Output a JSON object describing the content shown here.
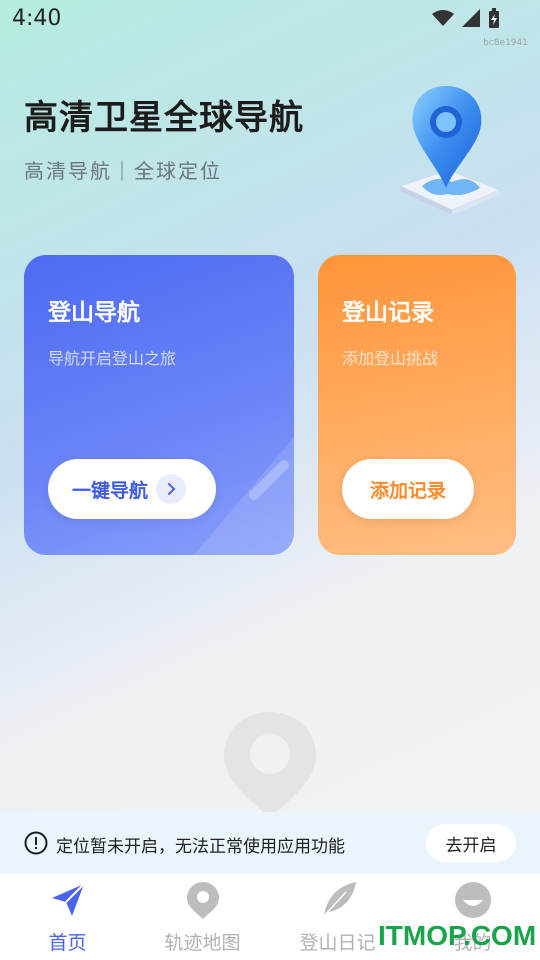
{
  "status_bar": {
    "time": "4:40",
    "watermark": "bc8e1941"
  },
  "header": {
    "title": "高清卫星全球导航",
    "subtitle": "高清导航｜全球定位"
  },
  "cards": {
    "navigation": {
      "title": "登山导航",
      "subtitle": "导航开启登山之旅",
      "button_label": "一键导航"
    },
    "record": {
      "title": "登山记录",
      "subtitle": "添加登山挑战",
      "button_label": "添加记录"
    }
  },
  "notice": {
    "text": "定位暂未开启，无法正常使用应用功能",
    "button_label": "去开启"
  },
  "tabs": [
    {
      "label": "首页",
      "icon": "paper-plane-icon",
      "active": true
    },
    {
      "label": "轨迹地图",
      "icon": "map-pin-icon",
      "active": false
    },
    {
      "label": "登山日记",
      "icon": "feather-icon",
      "active": false
    },
    {
      "label": "我的",
      "icon": "user-face-icon",
      "active": false
    }
  ],
  "watermark_brand": "ITMOP.COM",
  "colors": {
    "accent": "#4b63e9",
    "nav_card": "#5c78f5",
    "record_card": "#ff9d4a",
    "brand": "#19a34a"
  }
}
